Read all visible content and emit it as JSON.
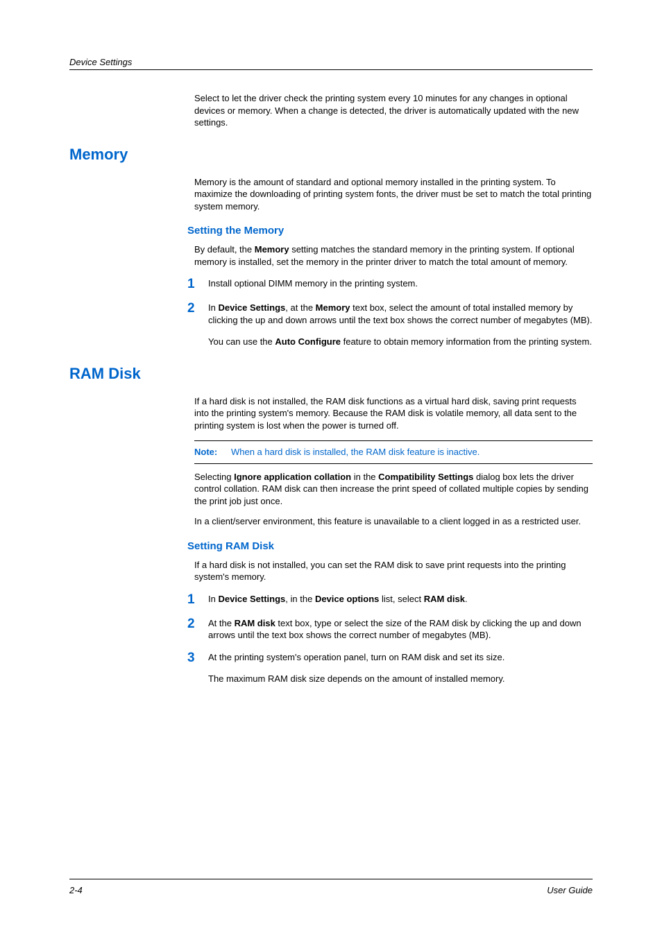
{
  "header": {
    "section_label": "Device Settings"
  },
  "intro_para": "Select to let the driver check the printing system every 10 minutes for any changes in optional devices or memory. When a change is detected, the driver is automatically updated with the new settings.",
  "memory": {
    "heading": "Memory",
    "intro": "Memory is the amount of standard and optional memory installed in the printing system. To maximize the downloading of printing system fonts, the driver must be set to match the total printing system memory.",
    "setting_heading": "Setting the Memory",
    "setting_intro_pre": "By default, the ",
    "setting_intro_bold": "Memory",
    "setting_intro_post": " setting matches the standard memory in the printing system. If optional memory is installed, set the memory in the printer driver to match the total amount of memory.",
    "step1": "Install optional DIMM memory in the printing system.",
    "step2_pre1": "In ",
    "step2_b1": "Device Settings",
    "step2_mid": ", at the ",
    "step2_b2": "Memory",
    "step2_post": " text box, select the amount of total installed memory by clicking the up and down arrows until the text box shows the correct number of megabytes (MB).",
    "step2_extra_pre": "You can use the ",
    "step2_extra_b": "Auto Configure",
    "step2_extra_post": " feature to obtain memory information from the printing system."
  },
  "ram": {
    "heading": "RAM Disk",
    "intro": "If a hard disk is not installed, the RAM disk functions as a virtual hard disk, saving print requests into the printing system's memory. Because the RAM disk is volatile memory, all data sent to the printing system is lost when the power is turned off.",
    "note_label": "Note:",
    "note_text": "When a hard disk is installed, the RAM disk feature is inactive.",
    "para2_pre": "Selecting ",
    "para2_b1": "Ignore application collation",
    "para2_mid": " in the ",
    "para2_b2": "Compatibility Settings",
    "para2_post": " dialog box lets the driver control collation. RAM disk can then increase the print speed of collated multiple copies by sending the print job just once.",
    "para3": "In a client/server environment, this feature is unavailable to a client logged in as a restricted user.",
    "setting_heading": "Setting RAM Disk",
    "setting_intro": "If a hard disk is not installed, you can set the RAM disk to save print requests into the printing system's memory.",
    "step1_pre": "In ",
    "step1_b1": "Device Settings",
    "step1_mid1": ", in the ",
    "step1_b2": "Device options",
    "step1_mid2": " list, select ",
    "step1_b3": "RAM disk",
    "step1_post": ".",
    "step2_pre": "At the ",
    "step2_b1": "RAM disk",
    "step2_post": " text box, type or select the size of the RAM disk by clicking the up and down arrows until the text box shows the correct number of megabytes (MB).",
    "step3": "At the printing system's operation panel, turn on RAM disk and set its size.",
    "step3_extra": "The maximum RAM disk size depends on the amount of installed memory."
  },
  "footer": {
    "page": "2-4",
    "label": "User Guide"
  },
  "nums": {
    "n1": "1",
    "n2": "2",
    "n3": "3"
  }
}
